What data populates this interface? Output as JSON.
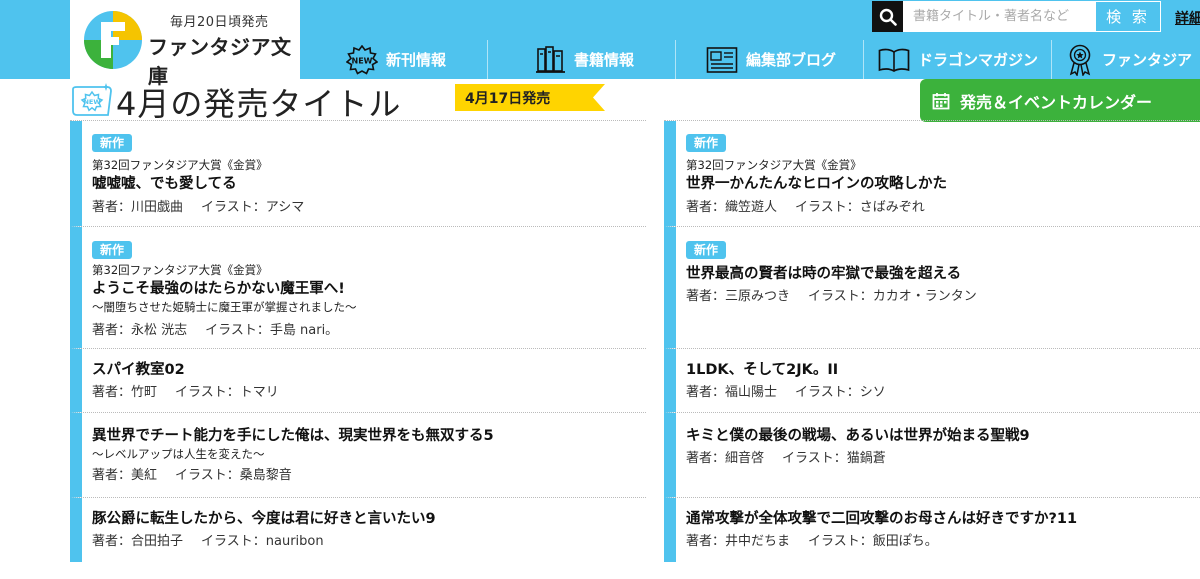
{
  "header": {
    "tagline": "毎月20日頃発売",
    "brand": "ファンタジア文庫",
    "search_placeholder": "書籍タイトル・著者名など",
    "search_button": "検 索",
    "detail_link": "詳細",
    "accent": "#4fc3ee"
  },
  "nav": [
    {
      "label": "新刊情報",
      "icon": "new-badge-icon"
    },
    {
      "label": "書籍情報",
      "icon": "books-icon"
    },
    {
      "label": "編集部ブログ",
      "icon": "newspaper-icon"
    },
    {
      "label": "ドラゴンマガジン",
      "icon": "open-book-icon"
    },
    {
      "label": "ファンタジア",
      "icon": "award-icon"
    }
  ],
  "page": {
    "title": "4月の発売タイトル",
    "release_date": "4月17日発売",
    "calendar_button": "発売＆イベントカレンダー",
    "ribbon_color": "#ffd400",
    "calendar_color": "#3cb23c"
  },
  "books_left": [
    {
      "badge": "新作",
      "award": "第32回ファンタジア大賞《金賞》",
      "title": "嘘嘘嘘、でも愛してる",
      "subtitle": "",
      "author": "著者：川田戯曲",
      "illust": "イラスト：アシマ"
    },
    {
      "badge": "新作",
      "award": "第32回ファンタジア大賞《金賞》",
      "title": "ようこそ最強のはたらかない魔王軍へ!",
      "subtitle": "～闇堕ちさせた姫騎士に魔王軍が掌握されました～",
      "author": "著者：永松 洸志",
      "illust": "イラスト：手島 nari。"
    },
    {
      "badge": "",
      "award": "",
      "title": "スパイ教室02",
      "subtitle": "",
      "author": "著者：竹町",
      "illust": "イラスト：トマリ"
    },
    {
      "badge": "",
      "award": "",
      "title": "異世界でチート能力を手にした俺は、現実世界をも無双する5",
      "subtitle": "～レベルアップは人生を変えた～",
      "author": "著者：美紅",
      "illust": "イラスト：桑島黎音"
    },
    {
      "badge": "",
      "award": "",
      "title": "豚公爵に転生したから、今度は君に好きと言いたい9",
      "subtitle": "",
      "author": "著者：合田拍子",
      "illust": "イラスト：nauribon"
    }
  ],
  "books_right": [
    {
      "badge": "新作",
      "award": "第32回ファンタジア大賞《金賞》",
      "title": "世界一かんたんなヒロインの攻略しかた",
      "subtitle": "",
      "author": "著者：織笠遊人",
      "illust": "イラスト：さばみぞれ"
    },
    {
      "badge": "新作",
      "award": "",
      "title": "世界最高の賢者は時の牢獄で最強を超える",
      "subtitle": "",
      "author": "著者：三原みつき",
      "illust": "イラスト：カカオ・ランタン"
    },
    {
      "badge": "",
      "award": "",
      "title": "1LDK、そして2JK。II",
      "subtitle": "",
      "author": "著者：福山陽士",
      "illust": "イラスト：シソ"
    },
    {
      "badge": "",
      "award": "",
      "title": "キミと僕の最後の戦場、あるいは世界が始まる聖戦9",
      "subtitle": "",
      "author": "著者：細音啓",
      "illust": "イラスト：猫鍋蒼"
    },
    {
      "badge": "",
      "award": "",
      "title": "通常攻撃が全体攻撃で二回攻撃のお母さんは好きですか?11",
      "subtitle": "",
      "author": "著者：井中だちま",
      "illust": "イラスト：飯田ぽち。"
    }
  ]
}
